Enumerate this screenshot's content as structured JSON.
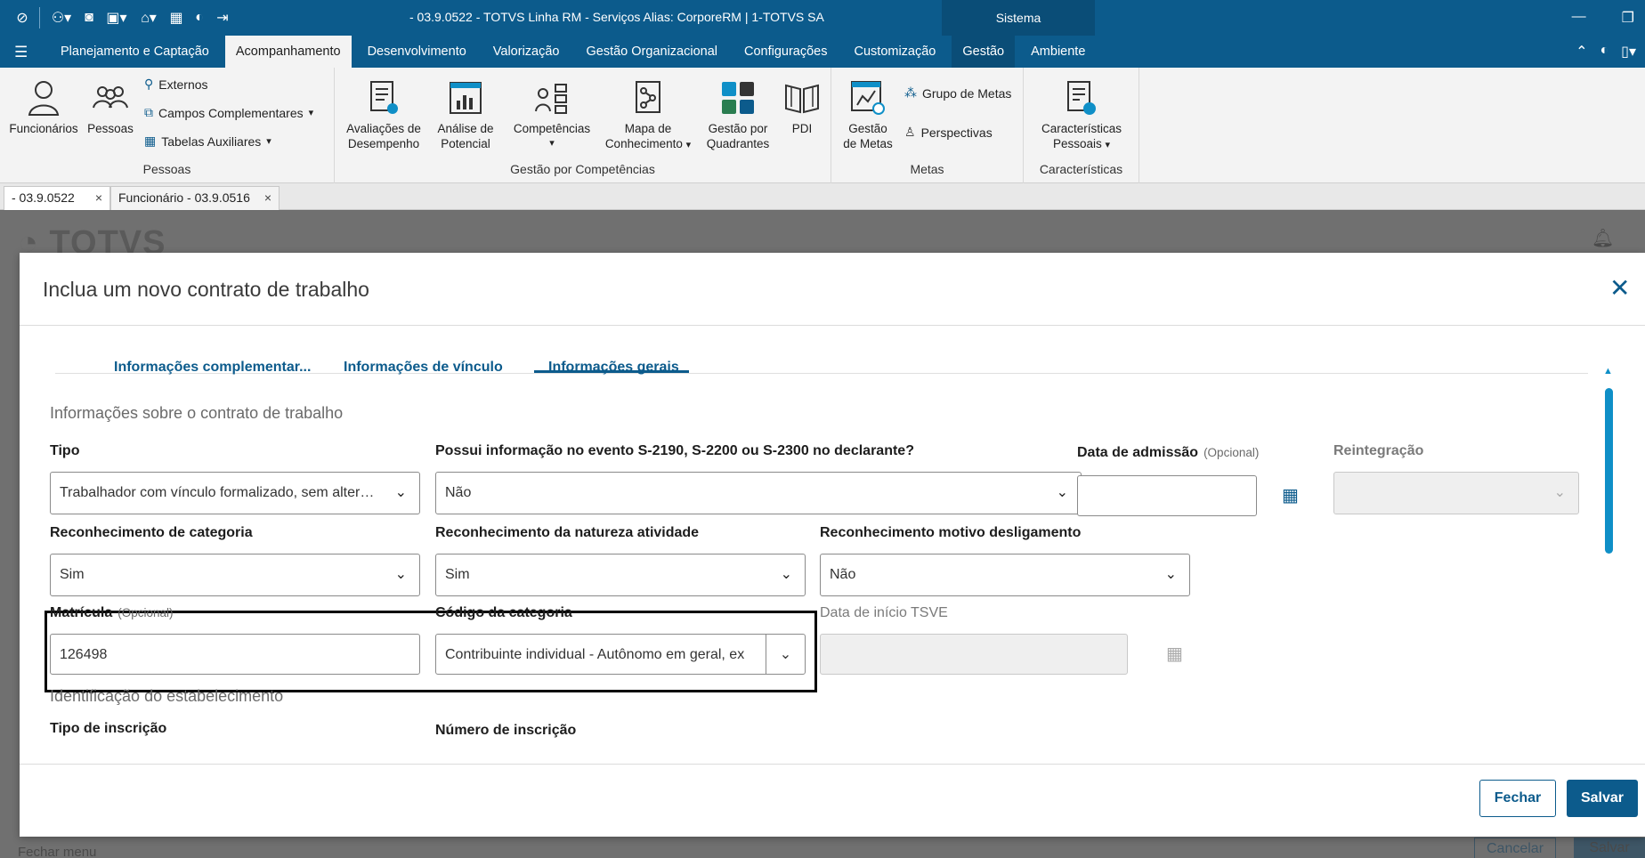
{
  "window": {
    "title": "- 03.9.0522 - TOTVS Linha RM - Serviços  Alias: CorporeRM | 1-TOTVS SA",
    "sistema": "Sistema"
  },
  "menu": {
    "items": [
      "Planejamento e Captação",
      "Acompanhamento",
      "Desenvolvimento",
      "Valorização",
      "Gestão Organizacional",
      "Configurações",
      "Customização",
      "Gestão",
      "Ambiente"
    ],
    "active": "Acompanhamento"
  },
  "ribbon": {
    "pessoas_group": {
      "label": "Pessoas",
      "funcionarios": "Funcionários",
      "pessoas": "Pessoas",
      "externos": "Externos",
      "campos_complementares": "Campos Complementares",
      "tabelas_auxiliares": "Tabelas Auxiliares"
    },
    "competencias_group": {
      "label": "Gestão por Competências",
      "avaliacoes_1": "Avaliações de",
      "avaliacoes_2": "Desempenho",
      "analise_1": "Análise de",
      "analise_2": "Potencial",
      "competencias": "Competências",
      "mapa_1": "Mapa de",
      "mapa_2": "Conhecimento",
      "quadrantes_1": "Gestão por",
      "quadrantes_2": "Quadrantes",
      "pdi": "PDI"
    },
    "metas_group": {
      "label": "Metas",
      "gestao_1": "Gestão",
      "gestao_2": "de Metas",
      "grupo_metas": "Grupo de Metas",
      "perspectivas": "Perspectivas"
    },
    "caracteristicas_group": {
      "label": "Características",
      "pessoais_1": "Características",
      "pessoais_2": "Pessoais"
    }
  },
  "doc_tabs": [
    {
      "label": "- 03.9.0522"
    },
    {
      "label": "Funcionário - 03.9.0516"
    }
  ],
  "background": {
    "logo": "TOTVS",
    "footer_left": "Fechar menu",
    "cancel": "Cancelar",
    "salvar": "Salvar"
  },
  "modal": {
    "title": "Inclua um novo contrato de trabalho",
    "tabs": [
      "Informações complementar...",
      "Informações de vínculo",
      "Informações gerais"
    ],
    "active_tab": "Informações gerais",
    "section1": "Informações sobre o contrato de trabalho",
    "section2": "Identificação do estabelecimento",
    "opcional": "(Opcional)",
    "fields": {
      "tipo": {
        "label": "Tipo",
        "value": "Trabalhador com vínculo formalizado, sem alteração..."
      },
      "possui_info": {
        "label": "Possui informação no evento S-2190, S-2200 ou S-2300 no declarante?",
        "value": "Não"
      },
      "data_admissao": {
        "label": "Data de admissão",
        "value": ""
      },
      "reintegracao": {
        "label": "Reintegração",
        "value": ""
      },
      "rec_categoria": {
        "label": "Reconhecimento de categoria",
        "value": "Sim"
      },
      "rec_natureza": {
        "label": "Reconhecimento da natureza atividade",
        "value": "Sim"
      },
      "rec_desligamento": {
        "label": "Reconhecimento motivo desligamento",
        "value": "Não"
      },
      "matricula": {
        "label": "Matrícula",
        "value": "126498"
      },
      "codigo_categoria": {
        "label": "Código da categoria",
        "value": "Contribuinte individual - Autônomo em geral, ex"
      },
      "data_tsve": {
        "label": "Data de início TSVE",
        "value": ""
      },
      "tipo_inscricao": {
        "label": "Tipo de inscrição"
      },
      "numero_inscricao": {
        "label": "Número de inscrição"
      }
    },
    "buttons": {
      "fechar": "Fechar",
      "salvar": "Salvar"
    }
  },
  "colors": {
    "primary": "#0c5b8c",
    "accent": "#0f8fc7"
  }
}
